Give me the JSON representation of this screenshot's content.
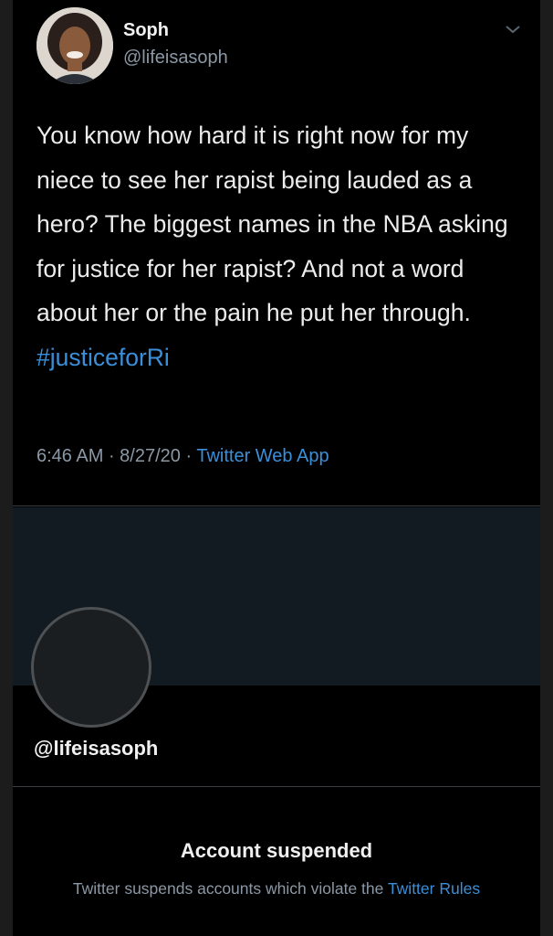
{
  "tweet": {
    "display_name": "Soph",
    "handle": "@lifeisasoph",
    "text": "You know how hard it is right now for my niece to see her rapist being lauded as a hero? The biggest names in the NBA asking for justice for her rapist? And not a word about her or the pain he put her through.",
    "hashtag": "#justiceforRi",
    "time": "6:46 AM",
    "date": "8/27/20",
    "source": "Twitter Web App",
    "separator": " · "
  },
  "profile": {
    "handle": "@lifeisasoph"
  },
  "suspension": {
    "title": "Account suspended",
    "text": "Twitter suspends accounts which violate the ",
    "link": "Twitter Rules"
  },
  "icons": {
    "chevron": "chevron-down-icon",
    "avatar": "user-photo-avatar"
  },
  "colors": {
    "background": "#000000",
    "link": "#3b8fd9",
    "secondary_text": "#8b98a5",
    "banner": "#121a22"
  }
}
